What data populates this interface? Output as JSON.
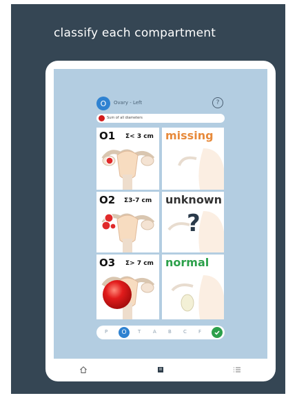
{
  "header": {
    "headline": "classify each compartment"
  },
  "panel": {
    "badge_letter": "O",
    "title": "Ovary - Left",
    "help_symbol": "?",
    "legend_text": "Sum of all diameters"
  },
  "grid": {
    "categories": [
      {
        "label": "O1",
        "range": "Σ< 3 cm"
      },
      {
        "label": "O2",
        "range": "Σ3-7 cm"
      },
      {
        "label": "O3",
        "range": "Σ> 7 cm"
      }
    ],
    "statuses": [
      {
        "label": "missing",
        "color": "#e78a3b"
      },
      {
        "label": "unknown",
        "color": "#333333",
        "symbol": "?"
      },
      {
        "label": "normal",
        "color": "#2ca04a"
      }
    ]
  },
  "stepper": {
    "steps": [
      "P",
      "O",
      "T",
      "A",
      "B",
      "C",
      "F"
    ],
    "active": "O",
    "complete_icon": "check-icon"
  },
  "tabbar": {
    "icons": [
      "home-icon",
      "clipboard-icon",
      "list-icon"
    ]
  },
  "colors": {
    "accent": "#2f82d1",
    "success": "#2ca04a",
    "warning": "#e78a3b",
    "lesion": "#d21d1d",
    "background": "#b3cde1"
  }
}
